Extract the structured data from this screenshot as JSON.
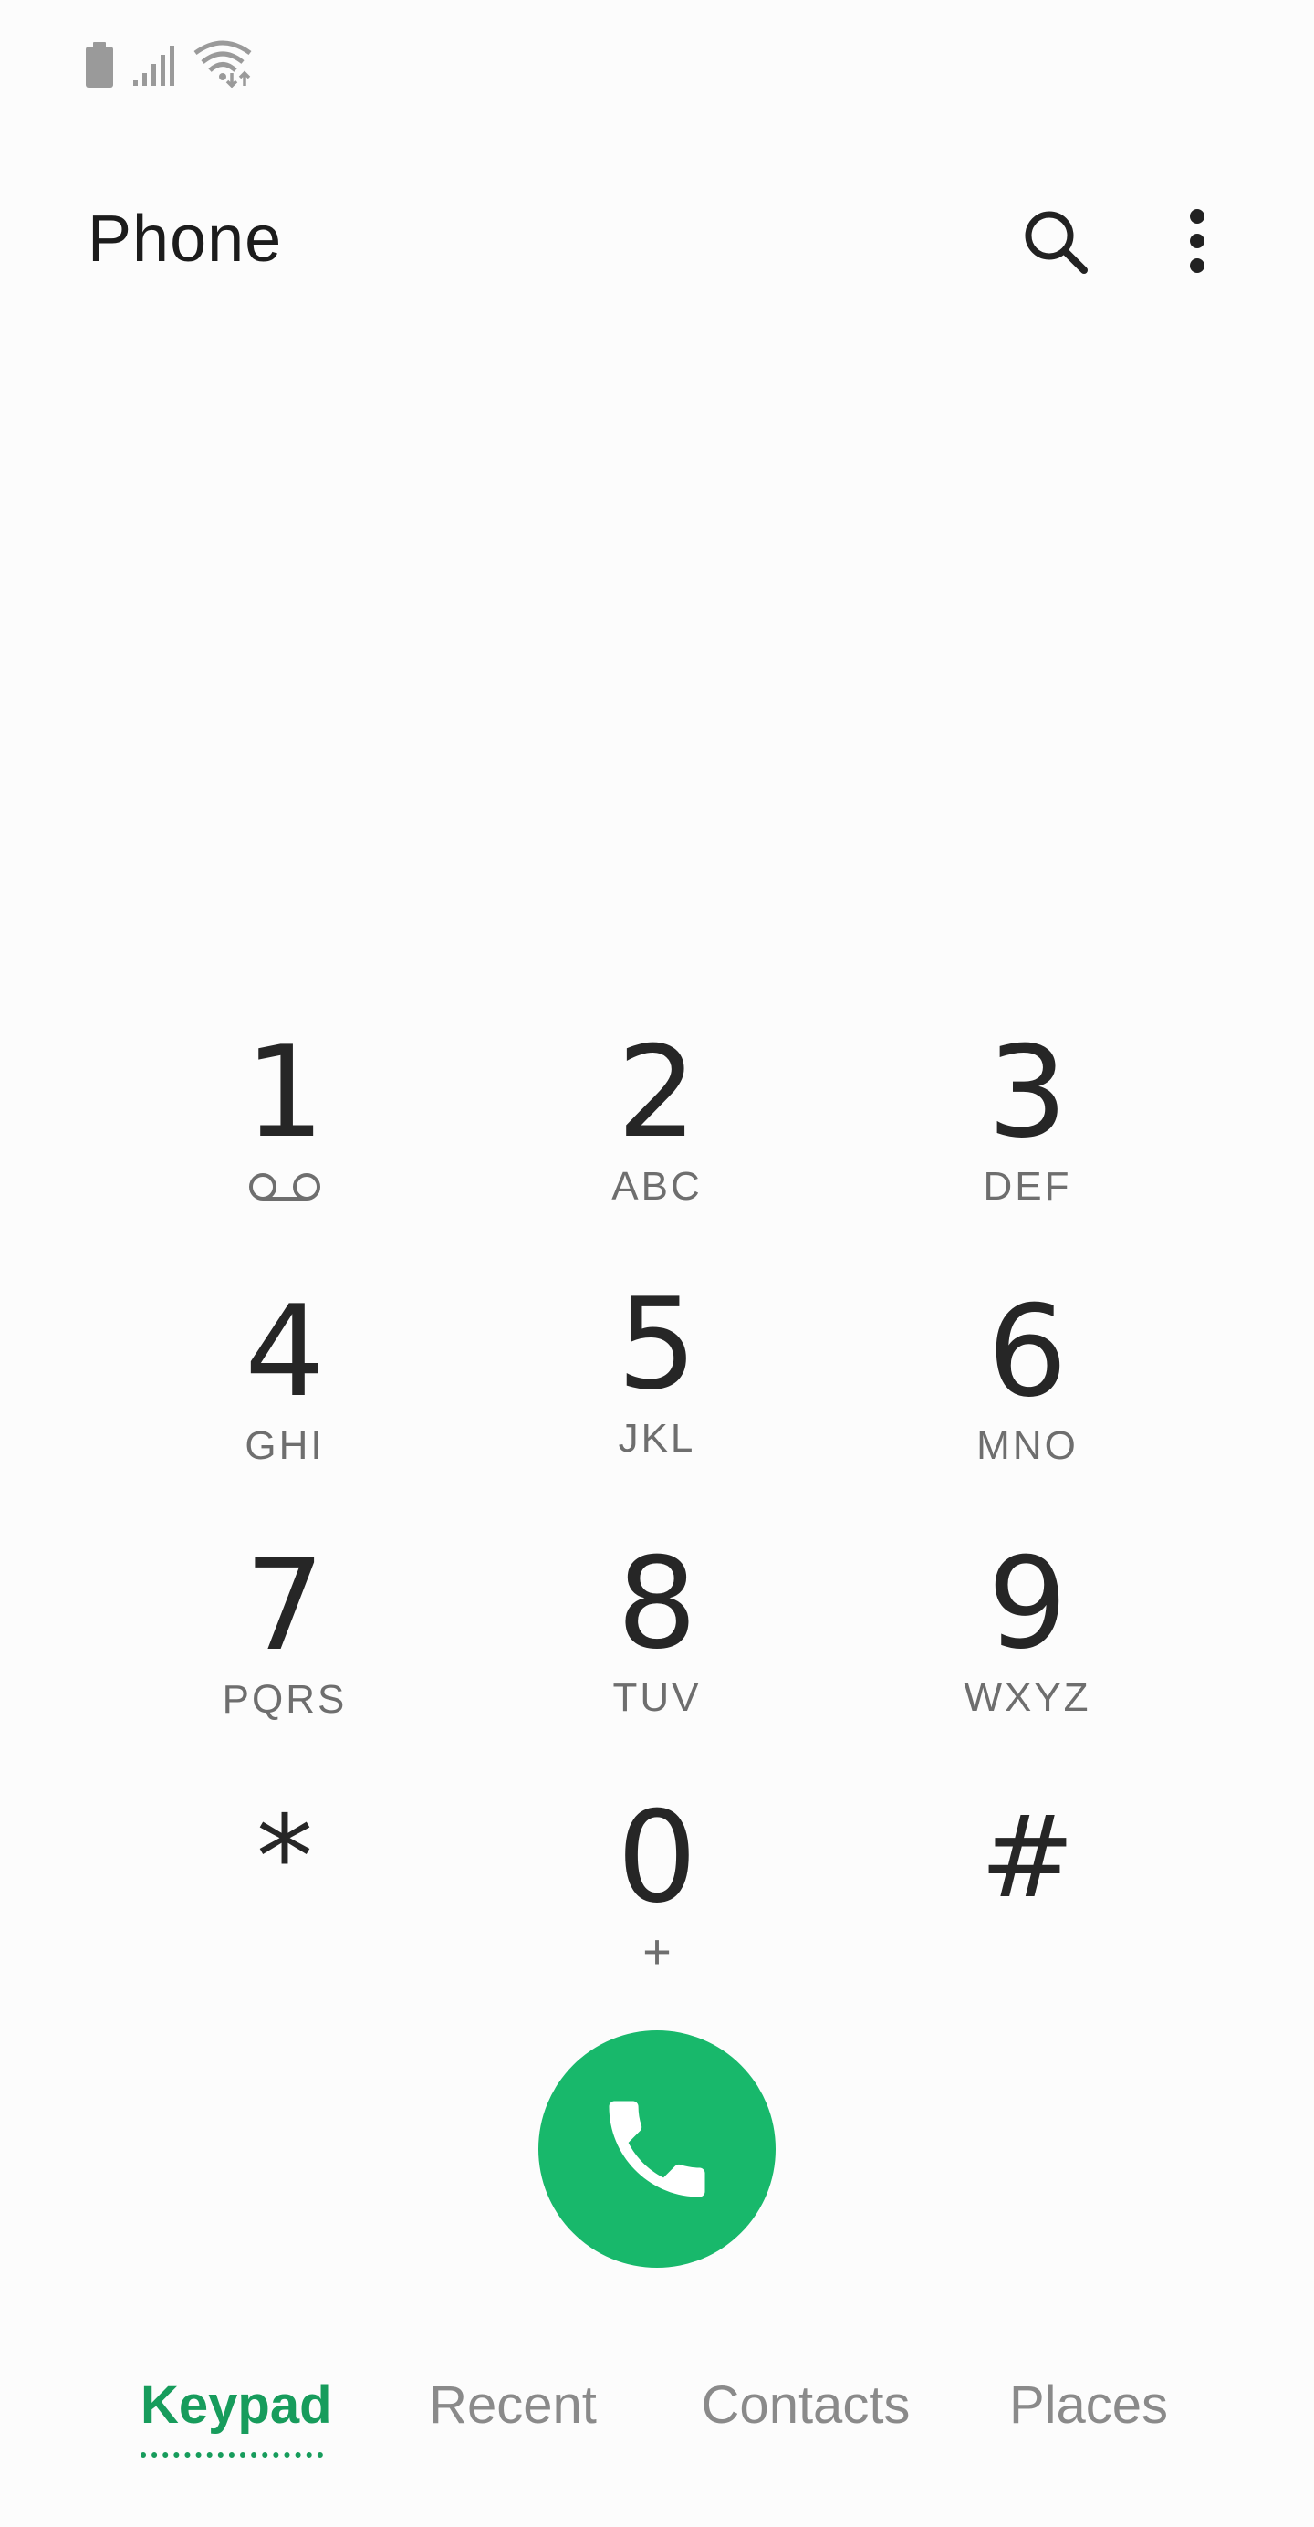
{
  "status_bar": {
    "icons": [
      "battery-icon",
      "signal-icon",
      "wifi-icon"
    ]
  },
  "header": {
    "title": "Phone",
    "icons": [
      "search-icon",
      "more-vert-icon"
    ]
  },
  "keypad": {
    "keys": [
      {
        "digit": "1",
        "letters": ""
      },
      {
        "digit": "2",
        "letters": "ABC"
      },
      {
        "digit": "3",
        "letters": "DEF"
      },
      {
        "digit": "4",
        "letters": "GHI"
      },
      {
        "digit": "5",
        "letters": "JKL"
      },
      {
        "digit": "6",
        "letters": "MNO"
      },
      {
        "digit": "7",
        "letters": "PQRS"
      },
      {
        "digit": "8",
        "letters": "TUV"
      },
      {
        "digit": "9",
        "letters": "WXYZ"
      },
      {
        "digit": "*",
        "letters": ""
      },
      {
        "digit": "0",
        "letters": "+"
      },
      {
        "digit": "#",
        "letters": ""
      }
    ],
    "voicemail_icon": "voicemail-icon"
  },
  "call_button": {
    "icon": "phone-icon",
    "color": "#18b86b"
  },
  "tabs": {
    "items": [
      {
        "label": "Keypad",
        "active": true
      },
      {
        "label": "Recent",
        "active": false
      },
      {
        "label": "Contacts",
        "active": false
      },
      {
        "label": "Places",
        "active": false
      }
    ],
    "accent_color": "#179c5c"
  }
}
